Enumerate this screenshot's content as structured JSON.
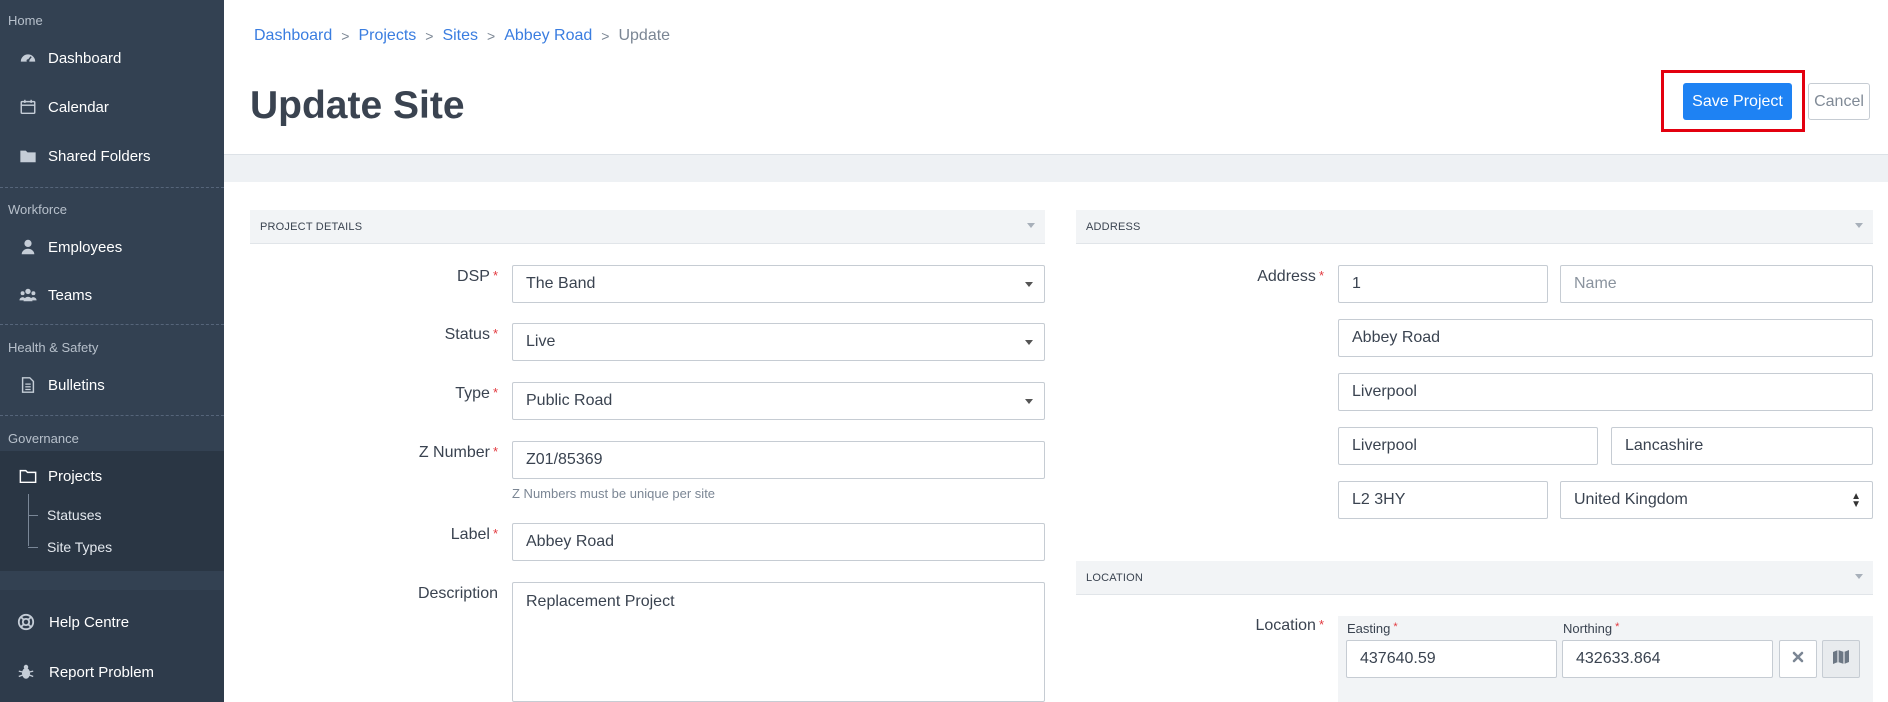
{
  "sidebar": {
    "sections": {
      "home": "Home",
      "workforce": "Workforce",
      "health_safety": "Health & Safety",
      "governance": "Governance"
    },
    "items": {
      "dashboard": "Dashboard",
      "calendar": "Calendar",
      "shared_folders": "Shared Folders",
      "employees": "Employees",
      "teams": "Teams",
      "bulletins": "Bulletins",
      "projects": "Projects"
    },
    "sub_items": {
      "statuses": "Statuses",
      "site_types": "Site Types"
    },
    "bottom": {
      "help_centre": "Help Centre",
      "report_problem": "Report Problem"
    }
  },
  "breadcrumb": [
    "Dashboard",
    "Projects",
    "Sites",
    "Abbey Road",
    "Update"
  ],
  "page_title": "Update Site",
  "actions": {
    "save": "Save Project",
    "cancel": "Cancel"
  },
  "project_details": {
    "heading": "PROJECT DETAILS",
    "dsp_label": "DSP",
    "dsp_value": "The Band",
    "status_label": "Status",
    "status_value": "Live",
    "type_label": "Type",
    "type_value": "Public Road",
    "z_label": "Z Number",
    "z_value": "Z01/85369",
    "z_help": "Z Numbers must be unique per site",
    "label_label": "Label",
    "label_value": "Abbey Road",
    "description_label": "Description",
    "description_value": "Replacement Project"
  },
  "address": {
    "heading": "ADDRESS",
    "label": "Address",
    "number": "1",
    "name_placeholder": "Name",
    "street": "Abbey Road",
    "locality": "Liverpool",
    "town": "Liverpool",
    "county": "Lancashire",
    "postcode": "L2 3HY",
    "country": "United Kingdom"
  },
  "location": {
    "heading": "LOCATION",
    "label": "Location",
    "easting_label": "Easting",
    "easting_value": "437640.59",
    "northing_label": "Northing",
    "northing_value": "432633.864"
  },
  "required_marker": "*",
  "breadcrumb_separator": ">",
  "colors": {
    "sidebar_bg": "#334152",
    "accent": "#1e82f3",
    "link": "#3a7de0",
    "required": "#e2393f",
    "highlight": "#e3000f"
  }
}
